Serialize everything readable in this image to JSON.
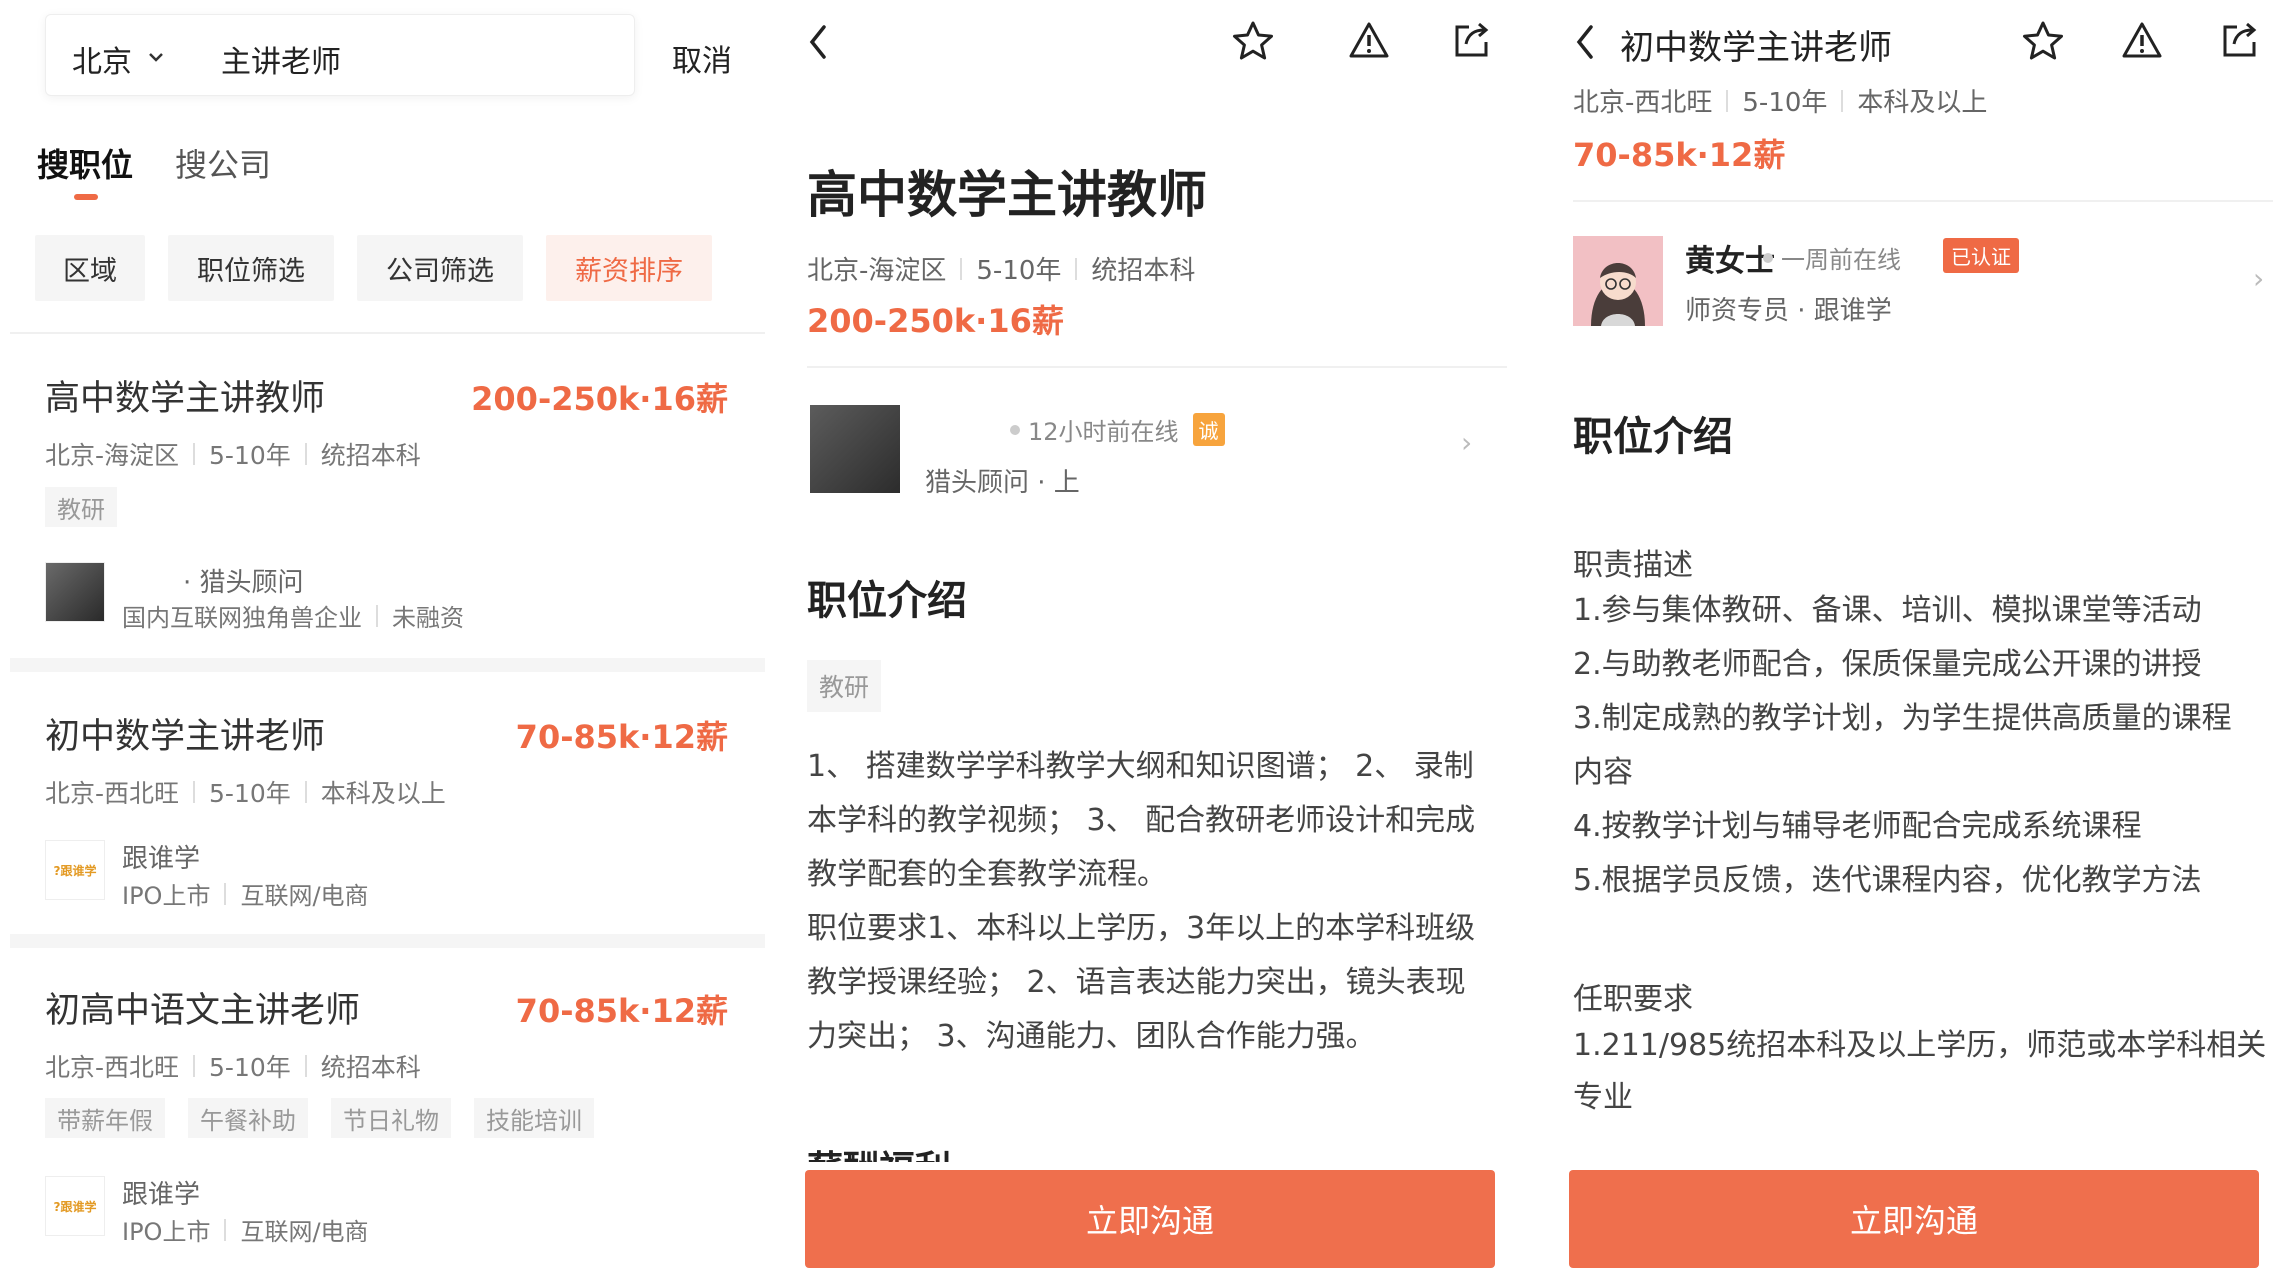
{
  "colors": {
    "accent": "#ef6a45",
    "button": "#ef6f4d"
  },
  "search_panel": {
    "city": "北京",
    "query": "主讲老师",
    "cancel": "取消",
    "tabs": [
      "搜职位",
      "搜公司"
    ],
    "filters": [
      "区域",
      "职位筛选",
      "公司筛选",
      "薪资排序"
    ],
    "jobs": [
      {
        "title": "高中数学主讲教师",
        "salary": "200-250k·16薪",
        "meta": [
          "北京-海淀区",
          "5-10年",
          "统招本科"
        ],
        "tags": [
          "教研"
        ],
        "recruiter_role": "· 猎头顾问",
        "company_meta": [
          "国内互联网独角兽企业",
          "未融资"
        ]
      },
      {
        "title": "初中数学主讲老师",
        "salary": "70-85k·12薪",
        "meta": [
          "北京-西北旺",
          "5-10年",
          "本科及以上"
        ],
        "company": "跟谁学",
        "company_meta": [
          "IPO上市",
          "互联网/电商"
        ]
      },
      {
        "title": "初高中语文主讲老师",
        "salary": "70-85k·12薪",
        "meta": [
          "北京-西北旺",
          "5-10年",
          "统招本科"
        ],
        "tags": [
          "带薪年假",
          "午餐补助",
          "节日礼物",
          "技能培训"
        ],
        "company": "跟谁学",
        "company_meta": [
          "IPO上市",
          "互联网/电商"
        ]
      }
    ]
  },
  "detail_panel_1": {
    "title": "高中数学主讲教师",
    "meta": [
      "北京-海淀区",
      "5-10年",
      "统招本科"
    ],
    "salary": "200-250k·16薪",
    "recruiter_online": "12小时前在线",
    "recruiter_badge": "诚",
    "recruiter_sub": "猎头顾问 · 上",
    "section_title": "职位介绍",
    "tag": "教研",
    "description": [
      "1、 搭建数学学科教学大纲和知识图谱； 2、 录制",
      "本学科的教学视频； 3、 配合教研老师设计和完成",
      "教学配套的全套教学流程。",
      "职位要求1、本科以上学历，3年以上的本学科班级",
      "教学授课经验； 2、语言表达能力突出，镜头表现",
      "力突出； 3、沟通能力、团队合作能力强。"
    ],
    "partial_heading": "薪酬福利",
    "cta": "立即沟通"
  },
  "detail_panel_2": {
    "header_title": "初中数学主讲老师",
    "meta": [
      "北京-西北旺",
      "5-10年",
      "本科及以上"
    ],
    "salary": "70-85k·12薪",
    "recruiter_name": "黄女士",
    "recruiter_online": "一周前在线",
    "recruiter_badge": "已认证",
    "recruiter_sub": "师资专员 · 跟谁学",
    "section_title": "职位介绍",
    "duty_heading": "职责描述",
    "duties": [
      "1.参与集体教研、备课、培训、模拟课堂等活动",
      "2.与助教老师配合，保质保量完成公开课的讲授",
      "3.制定成熟的教学计划，为学生提供高质量的课程",
      "内容",
      "4.按教学计划与辅导老师配合完成系统课程",
      "5.根据学员反馈，迭代课程内容，优化教学方法"
    ],
    "req_heading": "任职要求",
    "requirements": [
      "1.211/985统招本科及以上学历，师范或本学科相关",
      "专业"
    ],
    "cta": "立即沟通"
  }
}
